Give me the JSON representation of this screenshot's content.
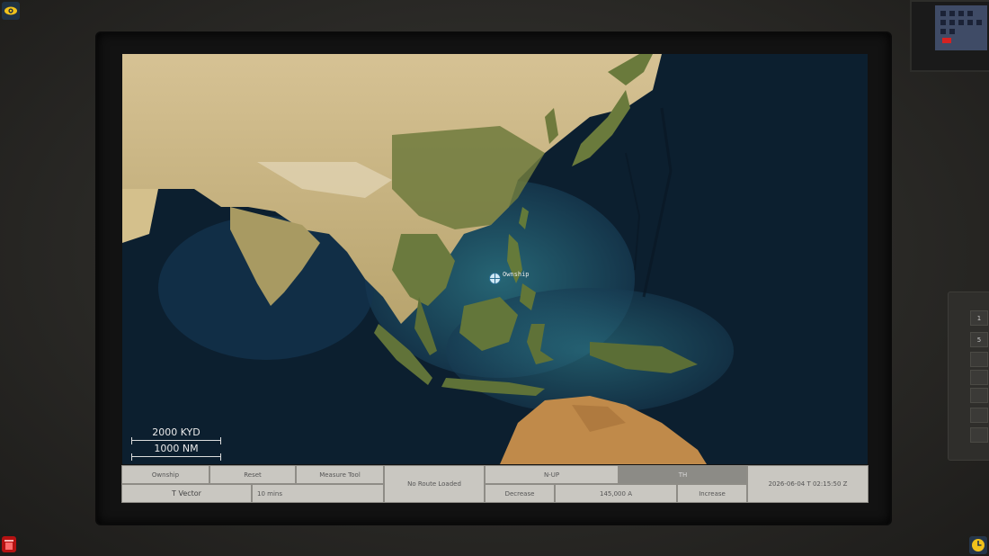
{
  "colors": {
    "panel_bg": "#7c7b76",
    "button_bg": "#c9c7c1",
    "button_active_bg": "#8c8b86",
    "ocean": "#0b1d2c",
    "land": "#9a8c5e",
    "trash_red": "#b51212",
    "accent_yellow": "#f1c21b"
  },
  "icons": {
    "top_left": "eye-icon",
    "top_right": "gear-icon",
    "bottom_left": "trash-icon",
    "bottom_right": "clock-icon"
  },
  "map": {
    "ownship_label": "Ownship",
    "scale_primary": "2000 KYD",
    "scale_secondary": "1000 NM"
  },
  "controls": {
    "ownship": "Ownship",
    "reset": "Reset",
    "measure_tool": "Measure Tool",
    "route_status": "No Route Loaded",
    "orientation": "N-UP",
    "mode": "TH",
    "vector_label": "T Vector",
    "vector_time": "10 mins",
    "decrease": "Decrease",
    "range": "145,000 A",
    "increase": "Increase",
    "datetime": "2026-06-04 T 02:15:50 Z"
  },
  "side_panel": {
    "keys": [
      "1",
      "5",
      "",
      "",
      "",
      "",
      ""
    ]
  }
}
